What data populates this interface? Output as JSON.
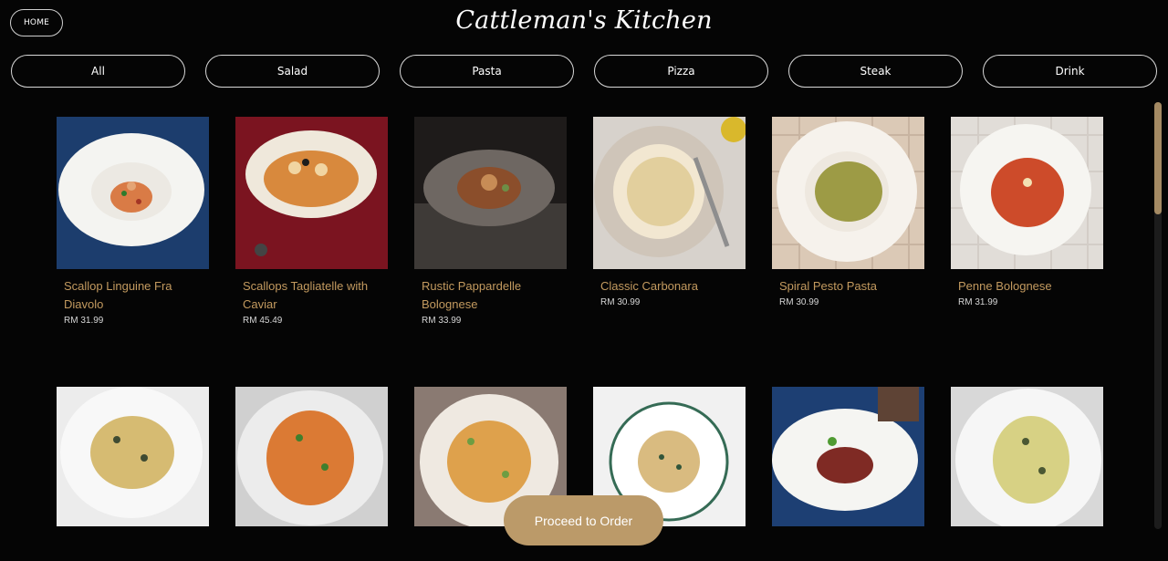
{
  "header": {
    "home_label": "HOME",
    "title": "Cattleman's Kitchen"
  },
  "categories": [
    {
      "label": "All"
    },
    {
      "label": "Salad"
    },
    {
      "label": "Pasta"
    },
    {
      "label": "Pizza"
    },
    {
      "label": "Steak"
    },
    {
      "label": "Drink"
    }
  ],
  "menu": {
    "items": [
      {
        "name": "Scallop Linguine Fra Diavolo",
        "price": "RM 31.99"
      },
      {
        "name": "Scallops Tagliatelle with Caviar",
        "price": "RM 45.49"
      },
      {
        "name": "Rustic Pappardelle Bolognese",
        "price": "RM 33.99"
      },
      {
        "name": "Classic Carbonara",
        "price": "RM 30.99"
      },
      {
        "name": "Spiral Pesto Pasta",
        "price": "RM 30.99"
      },
      {
        "name": "Penne Bolognese",
        "price": "RM 31.99"
      }
    ]
  },
  "order": {
    "button_label": "Proceed to Order"
  },
  "colors": {
    "accent": "#bb9a69",
    "item_name": "#c39a5f",
    "background": "#050505"
  },
  "icons": {
    "home": "none",
    "scrollbar": "vertical-scrollbar"
  }
}
